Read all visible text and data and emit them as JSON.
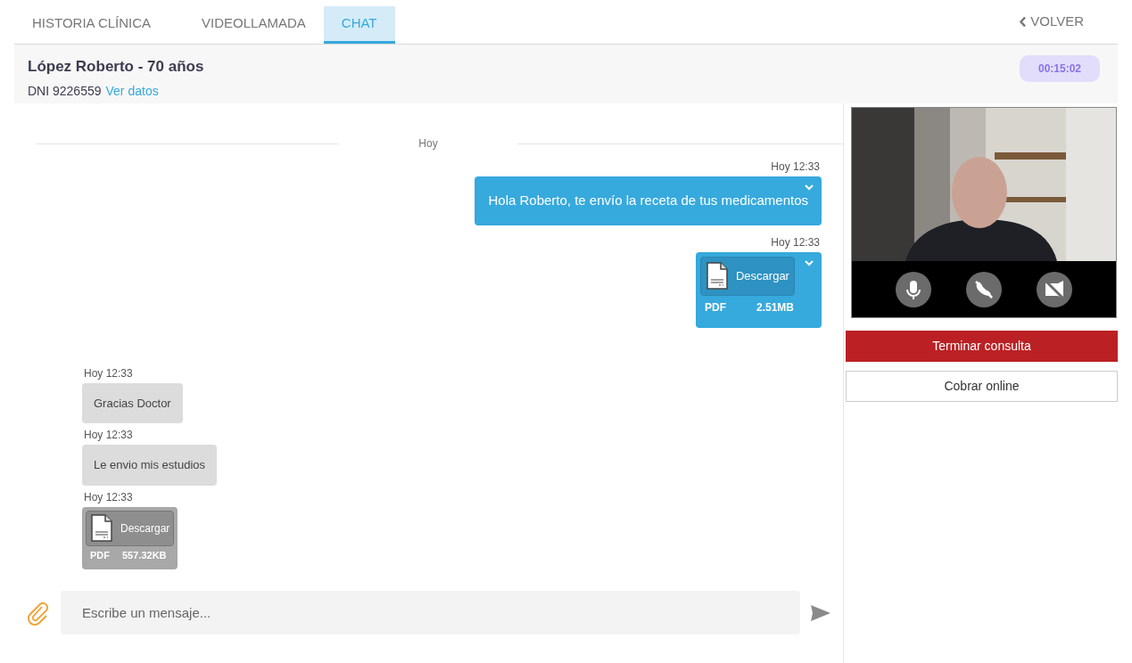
{
  "tabs": [
    {
      "label": "HISTORIA CLÍNICA",
      "selected": false
    },
    {
      "label": "VIDEOLLAMADA",
      "selected": false
    },
    {
      "label": "CHAT",
      "selected": true
    }
  ],
  "back": "VOLVER",
  "patient": {
    "name": "López Roberto - 70 años",
    "dni": "DNI 9226559",
    "link": "Ver datos",
    "timer": "00:15:02"
  },
  "chat": {
    "divider": "Hoy",
    "messages": [
      {
        "sent": true,
        "kind": "text",
        "time": "Hoy 12:33",
        "text": "Hola Roberto, te envío la receta de tus medicamentos"
      },
      {
        "sent": true,
        "kind": "file",
        "time": "Hoy 12:33",
        "button": "Descargar",
        "type": "PDF",
        "size": "2.51MB"
      },
      {
        "sent": false,
        "kind": "text",
        "time": "Hoy 12:33",
        "text": "Gracias Doctor"
      },
      {
        "sent": false,
        "kind": "text",
        "time": "Hoy 12:33",
        "text": "Le envio mis estudios"
      },
      {
        "sent": false,
        "kind": "file",
        "time": "Hoy 12:33",
        "button": "Descargar",
        "type": "PDF",
        "size": "557.32KB"
      }
    ],
    "placeholder": "Escribe un mensaje..."
  },
  "actions": [
    {
      "label": "Terminar consulta",
      "kind": "danger"
    },
    {
      "label": "Cobrar online",
      "kind": "outline"
    }
  ]
}
